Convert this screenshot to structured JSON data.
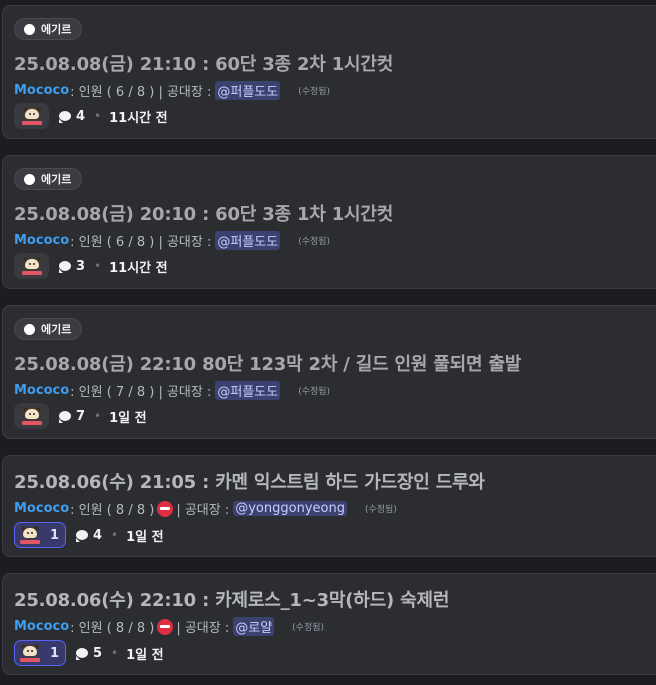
{
  "posts": [
    {
      "tag": "에기르",
      "title": "25.08.08(금) 21:10 : 60단 3종 2차 1시간컷",
      "author": "Mococo",
      "meta_prefix": ": 인원 ( 6 / 8 ) | 공대장 :",
      "mention": "@퍼플도도",
      "edited": "(수정됨)",
      "reaction_count": "",
      "comment_count": "4",
      "time": "11시간 전"
    },
    {
      "tag": "에기르",
      "title": "25.08.08(금) 20:10 : 60단 3종 1차 1시간컷",
      "author": "Mococo",
      "meta_prefix": ": 인원 ( 6 / 8 ) | 공대장 :",
      "mention": "@퍼플도도",
      "edited": "(수정됨)",
      "reaction_count": "",
      "comment_count": "3",
      "time": "11시간 전"
    },
    {
      "tag": "에기르",
      "title": "25.08.08(금) 22:10 80단 123막 2차 / 길드 인원 풀되면 출발",
      "author": "Mococo",
      "meta_prefix": ": 인원 ( 7 / 8 ) | 공대장 :",
      "mention": "@퍼플도도",
      "edited": "(수정됨)",
      "reaction_count": "",
      "comment_count": "7",
      "time": "1일 전"
    },
    {
      "tag": "",
      "title": "25.08.06(수) 21:05 : 카멘 익스트림 하드 가드장인 드루와",
      "author": "Mococo",
      "meta_prefix": ": 인원 ( 8 / 8 )",
      "meta_suffix": "| 공대장 :",
      "mention": "@yonggonyeong",
      "edited": "(수정됨)",
      "reaction_count": "1",
      "comment_count": "4",
      "time": "1일 전"
    },
    {
      "tag": "",
      "title": "25.08.06(수) 22:10 : 카제로스_1~3막(하드) 숙제런",
      "author": "Mococo",
      "meta_prefix": ": 인원 ( 8 / 8 )",
      "meta_suffix": "| 공대장 :",
      "mention": "@로얄",
      "edited": "(수정됨)",
      "reaction_count": "1",
      "comment_count": "5",
      "time": "1일 전"
    }
  ],
  "icons": {
    "tag_dot": "circle-icon",
    "comment": "speech-bubble-icon",
    "reaction_emoji": "mococo-emoji",
    "full_party": "no-entry-icon"
  },
  "colors": {
    "author": "#3e9df0",
    "mention_bg": "#3c4270",
    "reaction_active_border": "#5865f2",
    "no_entry": "#dd2e44"
  }
}
